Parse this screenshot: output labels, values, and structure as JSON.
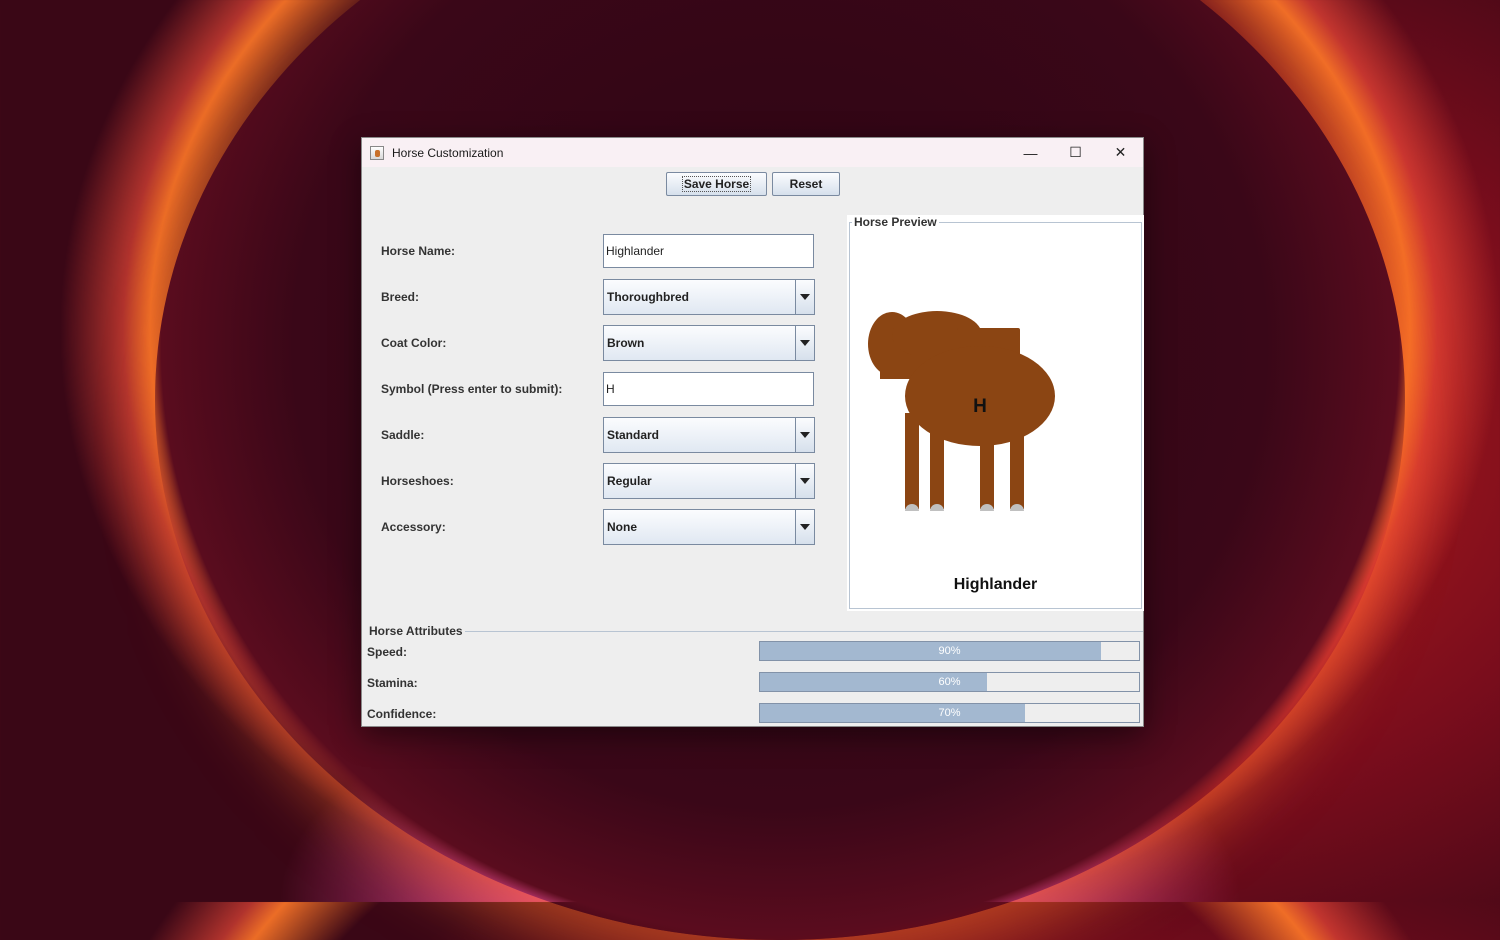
{
  "window": {
    "title": "Horse Customization",
    "controls": {
      "minimize": "—",
      "maximize": "☐",
      "close": "✕"
    }
  },
  "toolbar": {
    "save_label": "Save Horse",
    "reset_label": "Reset"
  },
  "form": {
    "name_label": "Horse Name:",
    "name_value": "Highlander",
    "breed_label": "Breed:",
    "breed_value": "Thoroughbred",
    "coat_label": "Coat Color:",
    "coat_value": "Brown",
    "symbol_label": "Symbol (Press enter to submit):",
    "symbol_value": "H",
    "saddle_label": "Saddle:",
    "saddle_value": "Standard",
    "horseshoes_label": "Horseshoes:",
    "horseshoes_value": "Regular",
    "accessory_label": "Accessory:",
    "accessory_value": "None"
  },
  "preview": {
    "title": "Horse Preview",
    "symbol": "H",
    "horse_name": "Highlander",
    "coat_color": "#8b4513",
    "hoof_color": "#c0c0c0"
  },
  "attributes": {
    "title": "Horse Attributes",
    "items": [
      {
        "label": "Speed:",
        "value": 0.9,
        "text": "90%"
      },
      {
        "label": "Stamina:",
        "value": 0.6,
        "text": "60%"
      },
      {
        "label": "Confidence:",
        "value": 0.7,
        "text": "70%"
      }
    ]
  }
}
